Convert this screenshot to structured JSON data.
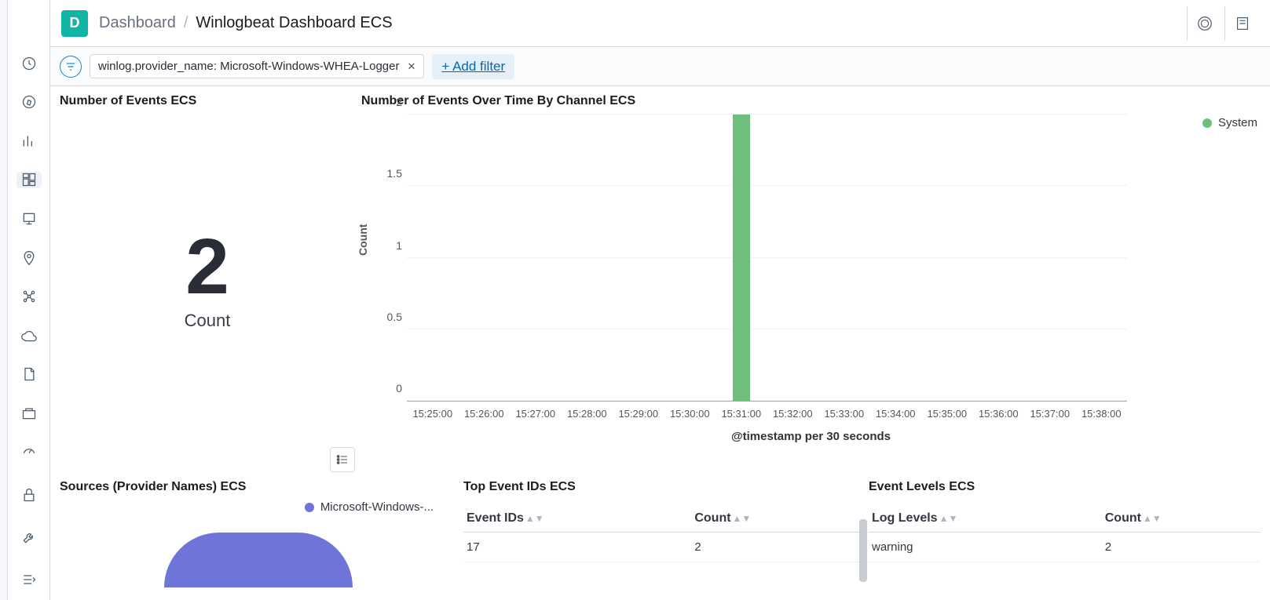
{
  "header": {
    "space_letter": "D",
    "breadcrumb_root": "Dashboard",
    "breadcrumb_current": "Winlogbeat Dashboard ECS"
  },
  "filter": {
    "pill_text": "winlog.provider_name: Microsoft-Windows-WHEA-Logger",
    "add_filter_label": "+ Add filter"
  },
  "metric": {
    "title": "Number of Events ECS",
    "value": "2",
    "label": "Count"
  },
  "chart_data": {
    "type": "bar",
    "title": "Number of Events Over Time By Channel ECS",
    "ylabel": "Count",
    "xlabel": "@timestamp per 30 seconds",
    "ylim": [
      0,
      2
    ],
    "yticks": [
      "0",
      "0.5",
      "1",
      "1.5",
      "2"
    ],
    "categories": [
      "15:25:00",
      "15:26:00",
      "15:27:00",
      "15:28:00",
      "15:29:00",
      "15:30:00",
      "15:31:00",
      "15:32:00",
      "15:33:00",
      "15:34:00",
      "15:35:00",
      "15:36:00",
      "15:37:00",
      "15:38:00"
    ],
    "series": [
      {
        "name": "System",
        "color": "#6dbf7b",
        "values": [
          0,
          0,
          0,
          0,
          0,
          0,
          2,
          0,
          0,
          0,
          0,
          0,
          0,
          0
        ]
      }
    ]
  },
  "sources": {
    "title": "Sources (Provider Names) ECS",
    "legend_item": "Microsoft-Windows-..."
  },
  "top_ids": {
    "title": "Top Event IDs ECS",
    "col1": "Event IDs",
    "col2": "Count",
    "rows": [
      {
        "id": "17",
        "count": "2"
      }
    ]
  },
  "levels": {
    "title": "Event Levels ECS",
    "col1": "Log Levels",
    "col2": "Count",
    "rows": [
      {
        "level": "warning",
        "count": "2"
      }
    ]
  }
}
